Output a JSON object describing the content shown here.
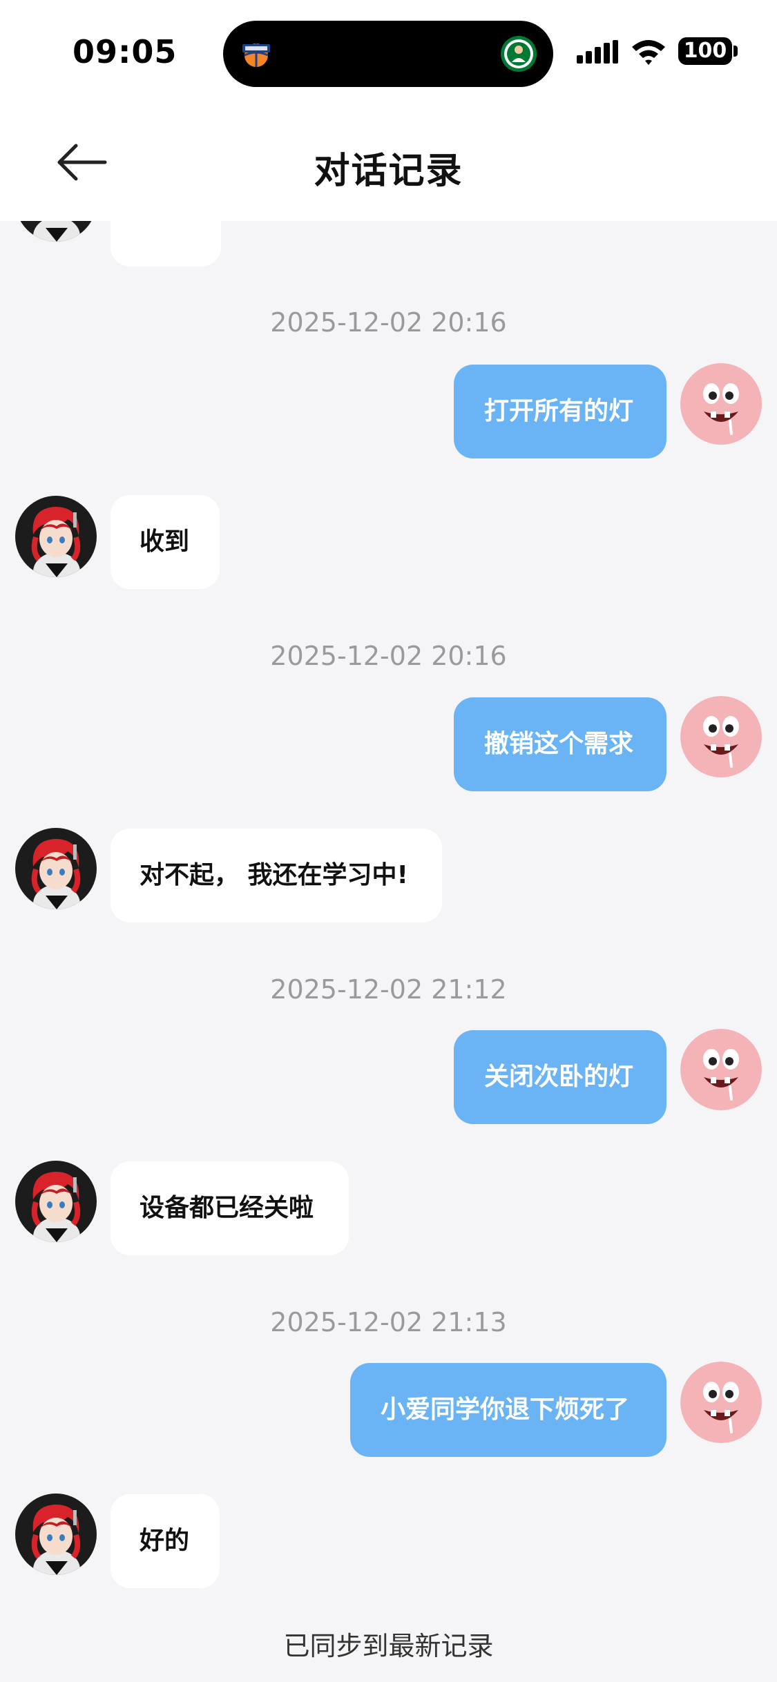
{
  "status_bar": {
    "time": "09:05",
    "battery": "100"
  },
  "header": {
    "title": "对话记录"
  },
  "messages": [
    {
      "timestamp": "2025-12-02 20:16",
      "user": "打开所有的灯",
      "bot": "收到"
    },
    {
      "timestamp": "2025-12-02 20:16",
      "user": "撤销这个需求",
      "bot": "对不起， 我还在学习中!"
    },
    {
      "timestamp": "2025-12-02 21:12",
      "user": "关闭次卧的灯",
      "bot": "设备都已经关啦"
    },
    {
      "timestamp": "2025-12-02 21:13",
      "user": "小爱同学你退下烦死了",
      "bot": "好的"
    }
  ],
  "footer": {
    "sync_status": "已同步到最新记录"
  },
  "colors": {
    "user_bubble": "#6ab4f5",
    "bot_bubble": "#ffffff",
    "background": "#f5f5f7"
  }
}
